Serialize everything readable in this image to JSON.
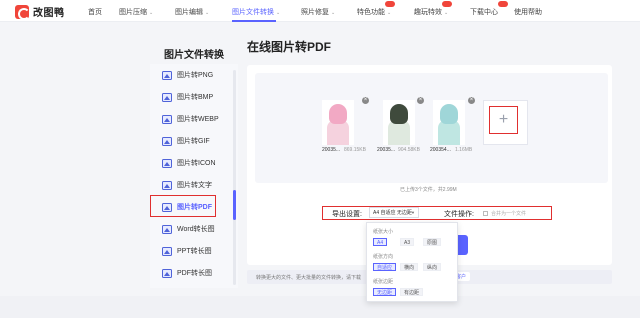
{
  "brand": {
    "name": "改图鸭"
  },
  "nav": {
    "items": [
      {
        "label": "首页",
        "chevron": false,
        "badge": false,
        "active": false
      },
      {
        "label": "图片压缩",
        "chevron": true,
        "badge": false,
        "active": false
      },
      {
        "label": "图片编辑",
        "chevron": true,
        "badge": false,
        "active": false
      },
      {
        "label": "图片文件转换",
        "chevron": true,
        "badge": false,
        "active": true
      },
      {
        "label": "照片修复",
        "chevron": true,
        "badge": false,
        "active": false
      },
      {
        "label": "特色功能",
        "chevron": true,
        "badge": true,
        "active": false
      },
      {
        "label": "趣玩特效",
        "chevron": true,
        "badge": true,
        "active": false
      },
      {
        "label": "下载中心",
        "chevron": false,
        "badge": true,
        "active": false
      },
      {
        "label": "使用帮助",
        "chevron": false,
        "badge": false,
        "active": false
      }
    ],
    "chevron_glyph": "⌄",
    "active_color": "#5a63ff"
  },
  "sidebar": {
    "title": "图片文件转换",
    "items": [
      {
        "label": "图片转PNG",
        "icon": "image-icon"
      },
      {
        "label": "图片转BMP",
        "icon": "image-icon"
      },
      {
        "label": "图片转WEBP",
        "icon": "image-icon"
      },
      {
        "label": "图片转GIF",
        "icon": "image-icon"
      },
      {
        "label": "图片转ICON",
        "icon": "image-icon"
      },
      {
        "label": "图片转文字",
        "icon": "image-icon"
      },
      {
        "label": "图片转PDF",
        "icon": "image-icon",
        "active": true
      },
      {
        "label": "Word转长图",
        "icon": "image-icon"
      },
      {
        "label": "PPT转长图",
        "icon": "image-icon"
      },
      {
        "label": "PDF转长图",
        "icon": "image-icon"
      }
    ]
  },
  "main": {
    "title": "在线图片转PDF",
    "files": [
      {
        "name": "20035...",
        "size": "869.15KB"
      },
      {
        "name": "20035...",
        "size": "904.58KB"
      },
      {
        "name": "200354...",
        "size": "1.16MB"
      }
    ],
    "add_symbol": "+",
    "upload_count": "已上传3个文件，共2.99M",
    "export_label": "导出设置:",
    "export_value": "A4 自适应 无边距",
    "file_op_label": "文件操作:",
    "merge_label": "合并为一个文件",
    "tip_text": "转换更大的文件、更大批量的文件转换，请下载",
    "tip_link": "客户",
    "close_glyph": "×"
  },
  "dropdown": {
    "groups": [
      {
        "label": "纸张大小",
        "options": [
          "A4",
          "A3",
          "原图"
        ],
        "selected": 0
      },
      {
        "label": "纸张方向",
        "options": [
          "自适应",
          "横向",
          "纵向"
        ],
        "selected": 0
      },
      {
        "label": "纸张边距",
        "options": [
          "无边距",
          "有边距"
        ],
        "selected": 0
      }
    ]
  },
  "colors": {
    "accent": "#5a63ff",
    "highlight_red": "#e02f2f",
    "brand_red": "#f0453a"
  }
}
